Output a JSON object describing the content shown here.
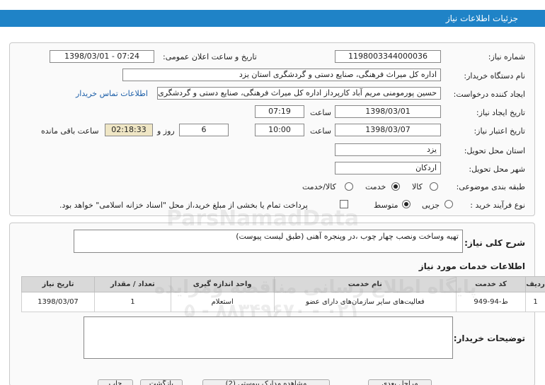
{
  "header": {
    "title": "جزئیات اطلاعات نیاز"
  },
  "form": {
    "need_number_label": "شماره نیاز:",
    "need_number": "1198003344000036",
    "announce_label": "تاریخ و ساعت اعلان عمومی:",
    "announce_value": "1398/03/01 - 07:24",
    "buyer_org_label": "نام دستگاه خریدار:",
    "buyer_org": "اداره کل میراث فرهنگی، صنایع دستی و گردشگری استان یزد",
    "requester_label": "ایجاد کننده درخواست:",
    "requester": "حسین پورمومنی مریم آباد کارپرداز اداره کل میراث فرهنگی، صنایع دستی و گردشگری",
    "contact_link": "اطلاعات تماس خریدار",
    "created_label": "تاریخ ایجاد نیاز:",
    "created_date": "1398/03/01",
    "time_label": "ساعت",
    "created_time": "07:19",
    "validity_label": "تاریخ اعتبار نیاز:",
    "validity_date": "1398/03/07",
    "validity_time": "10:00",
    "days": "6",
    "days_label": "روز و",
    "remaining": "02:18:33",
    "remaining_label": "ساعت باقی مانده",
    "province_label": "استان محل تحویل:",
    "province": "یزد",
    "city_label": "شهر محل تحویل:",
    "city": "اردکان",
    "category_label": "طبقه بندی موضوعی:",
    "category_options": [
      "کالا",
      "خدمت",
      "کالا/خدمت"
    ],
    "process_label": "نوع فرآیند خرید :",
    "process_options": [
      "جزیی",
      "متوسط"
    ],
    "payment_note": "پرداخت تمام یا بخشی از مبلغ خرید،از محل \"اسناد خزانه اسلامی\" خواهد بود."
  },
  "summary": {
    "label": "شرح کلی نیاز:",
    "text": "تهیه وساخت ونصب چهار چوب ،در وپنجره آهنی (طبق لیست پیوست)"
  },
  "services": {
    "title": "اطلاعات خدمات مورد نیاز",
    "columns": [
      "ردیف",
      "کد خدمت",
      "نام خدمت",
      "واحد اندازه گیری",
      "تعداد / مقدار",
      "تاریخ نیاز"
    ],
    "rows": [
      {
        "row": "1",
        "code": "ط-94-949",
        "name": "فعالیت‌های سایر سازمان‌های دارای عضو",
        "unit": "استعلام",
        "qty": "1",
        "date": "1398/03/07"
      }
    ]
  },
  "buyer_notes": {
    "label": "توضیحات خریدار:"
  },
  "watermark": {
    "brand": "ParsNamadData",
    "line1": "پایگاه اطلاع رسانی مناقصه ومزایده",
    "line2": "۰۲۱ - ۸۸۳۴۹۶۷۰ - ۵"
  },
  "bottom_buttons": [
    "چاپ",
    "بازگشت",
    "مشاهده مدارک پیوستی (2)",
    "مراحل بعدی"
  ],
  "colors": {
    "header": "#1f83c7",
    "link": "#1d5fa8",
    "remaining_bg": "#efe6c5"
  }
}
